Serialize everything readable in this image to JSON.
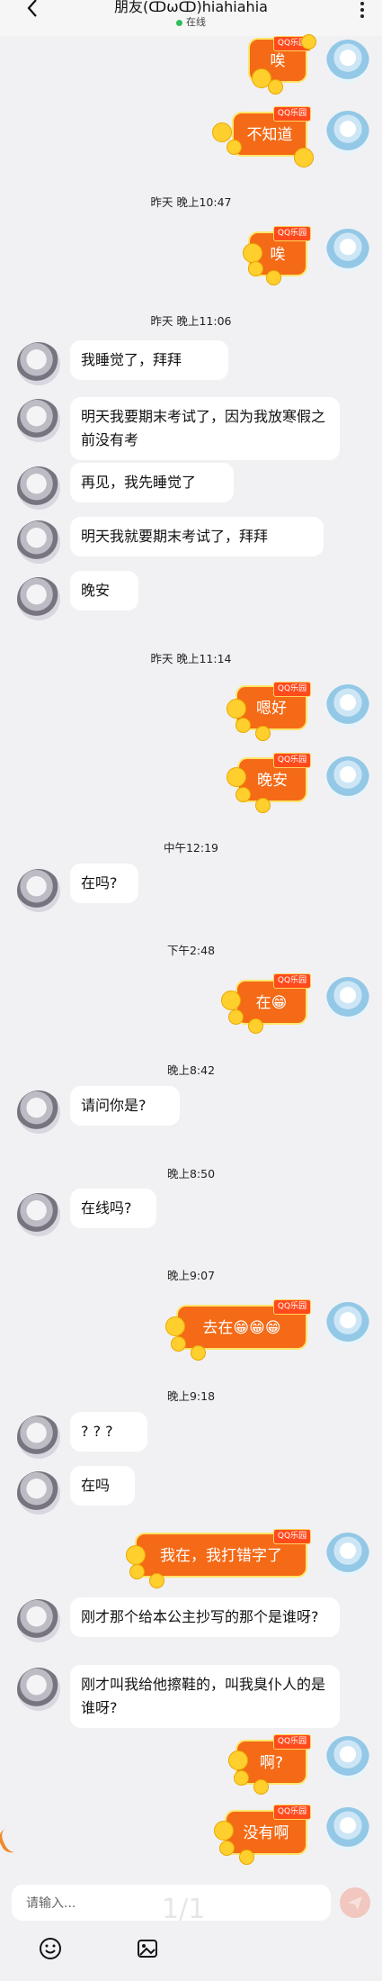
{
  "header": {
    "title": "朋友(ↀωↀ)hiahiahia",
    "status": "在线"
  },
  "timestamps": [
    "昨天 晚上10:47",
    "昨天 晚上11:06",
    "昨天 晚上11:14",
    "中午12:19",
    "下午2:48",
    "晚上8:42",
    "晚上8:50",
    "晚上9:07",
    "晚上9:18"
  ],
  "messages": [
    {
      "side": "right",
      "text": "唉"
    },
    {
      "side": "right",
      "text": "不知道"
    },
    {
      "side": "right",
      "text": "唉"
    },
    {
      "side": "left",
      "text": "我睡觉了，拜拜"
    },
    {
      "side": "left",
      "text": "明天我要期末考试了，因为我放寒假之前没有考"
    },
    {
      "side": "left",
      "text": "再见，我先睡觉了"
    },
    {
      "side": "left",
      "text": "明天我就要期末考试了，拜拜"
    },
    {
      "side": "left",
      "text": "晚安"
    },
    {
      "side": "right",
      "text": "嗯好"
    },
    {
      "side": "right",
      "text": "晚安"
    },
    {
      "side": "left",
      "text": "在吗?"
    },
    {
      "side": "right",
      "text": "在😁"
    },
    {
      "side": "left",
      "text": "请问你是?"
    },
    {
      "side": "left",
      "text": "在线吗?"
    },
    {
      "side": "right",
      "text": "去在😁😁😁"
    },
    {
      "side": "left",
      "text": "? ? ?"
    },
    {
      "side": "left",
      "text": "在吗"
    },
    {
      "side": "right",
      "text": "我在，我打错字了"
    },
    {
      "side": "left",
      "text": "刚才那个给本公主抄写的那个是谁呀?"
    },
    {
      "side": "left",
      "text": "刚才叫我给他擦鞋的，叫我臭仆人的是谁呀?"
    },
    {
      "side": "right",
      "text": "啊?"
    },
    {
      "side": "right",
      "text": "没有啊"
    }
  ],
  "bubble_badge": "QQ乐园",
  "input": {
    "placeholder": "请输入..."
  },
  "pager": "1/1",
  "icons": {
    "back": "chevron-left-icon",
    "more": "more-vertical-icon",
    "send": "send-icon",
    "emoji": "emoji-icon",
    "image": "image-icon"
  },
  "colors": {
    "bubble_right": "#f46a17",
    "bubble_left": "#ffffff",
    "online": "#2fbf5a"
  }
}
